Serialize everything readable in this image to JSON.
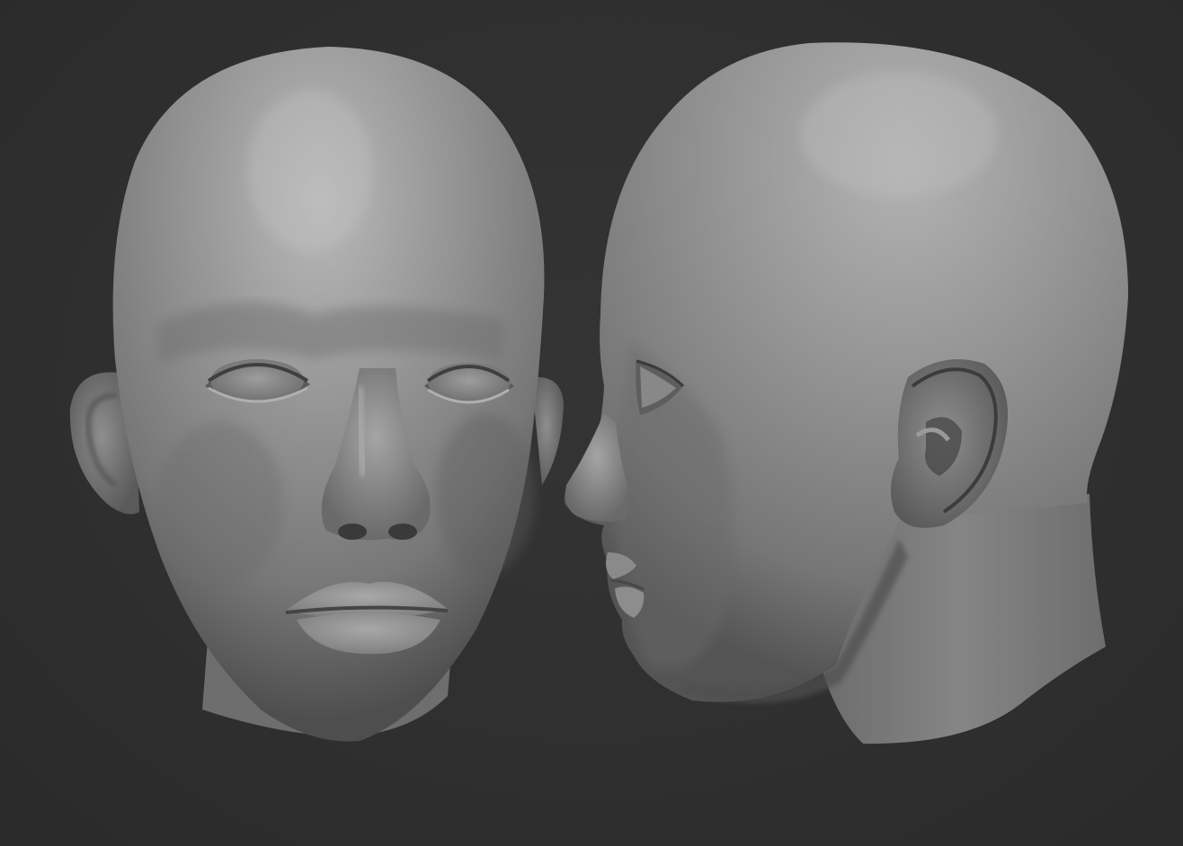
{
  "scene": {
    "background_color": "#303030",
    "clay_color": "#8a8a8a",
    "models": [
      {
        "name": "front-view-head"
      },
      {
        "name": "side-view-head"
      }
    ]
  }
}
